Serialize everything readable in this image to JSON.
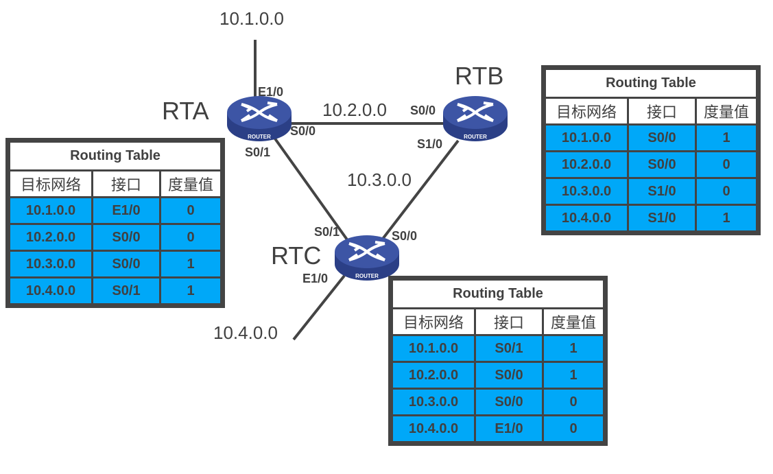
{
  "colors": {
    "row_fill": "#00a8f8",
    "line": "#444444",
    "router": "#3d55a5"
  },
  "networks": [
    "10.1.0.0",
    "10.2.0.0",
    "10.3.0.0",
    "10.4.0.0"
  ],
  "routers": {
    "rta": {
      "name": "RTA",
      "label": "ROUTER",
      "interfaces": {
        "e10": "E1/0",
        "s00": "S0/0",
        "s01": "S0/1"
      }
    },
    "rtb": {
      "name": "RTB",
      "label": "ROUTER",
      "interfaces": {
        "s00": "S0/0",
        "s10": "S1/0"
      }
    },
    "rtc": {
      "name": "RTC",
      "label": "ROUTER",
      "interfaces": {
        "s01": "S0/1",
        "s00": "S0/0",
        "e10": "E1/0"
      }
    }
  },
  "tables": {
    "rta": {
      "title": "Routing Table",
      "headers": [
        "目标网络",
        "接口",
        "度量值"
      ],
      "rows": [
        [
          "10.1.0.0",
          "E1/0",
          "0"
        ],
        [
          "10.2.0.0",
          "S0/0",
          "0"
        ],
        [
          "10.3.0.0",
          "S0/0",
          "1"
        ],
        [
          "10.4.0.0",
          "S0/1",
          "1"
        ]
      ]
    },
    "rtb": {
      "title": "Routing Table",
      "headers": [
        "目标网络",
        "接口",
        "度量值"
      ],
      "rows": [
        [
          "10.1.0.0",
          "S0/0",
          "1"
        ],
        [
          "10.2.0.0",
          "S0/0",
          "0"
        ],
        [
          "10.3.0.0",
          "S1/0",
          "0"
        ],
        [
          "10.4.0.0",
          "S1/0",
          "1"
        ]
      ]
    },
    "rtc": {
      "title": "Routing Table",
      "headers": [
        "目标网络",
        "接口",
        "度量值"
      ],
      "rows": [
        [
          "10.1.0.0",
          "S0/1",
          "1"
        ],
        [
          "10.2.0.0",
          "S0/0",
          "1"
        ],
        [
          "10.3.0.0",
          "S0/0",
          "0"
        ],
        [
          "10.4.0.0",
          "E1/0",
          "0"
        ]
      ]
    }
  }
}
